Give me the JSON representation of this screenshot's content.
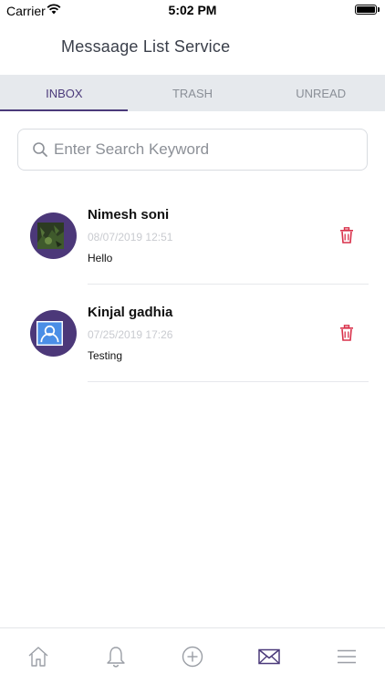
{
  "status_bar": {
    "carrier": "Carrier",
    "time": "5:02 PM"
  },
  "header": {
    "title": "Messaage List Service"
  },
  "tabs": [
    {
      "label": "INBOX",
      "active": true
    },
    {
      "label": "TRASH",
      "active": false
    },
    {
      "label": "UNREAD",
      "active": false
    }
  ],
  "search": {
    "placeholder": "Enter Search Keyword",
    "value": ""
  },
  "messages": [
    {
      "sender": "Nimesh soni",
      "date": "08/07/2019 12:51",
      "preview": "Hello",
      "avatar": "photo-avatar"
    },
    {
      "sender": "Kinjal gadhia",
      "date": "07/25/2019 17:26",
      "preview": "Testing",
      "avatar": "default-user-avatar"
    }
  ],
  "bottom_nav": [
    {
      "name": "home-icon"
    },
    {
      "name": "bell-icon"
    },
    {
      "name": "add-circle-icon"
    },
    {
      "name": "mail-icon",
      "active": true
    },
    {
      "name": "menu-icon"
    }
  ],
  "colors": {
    "accent": "#4b3a7a",
    "delete": "#d9304a",
    "tab_bar": "#e6e9ed",
    "avatar_bg": "#4c3879"
  }
}
